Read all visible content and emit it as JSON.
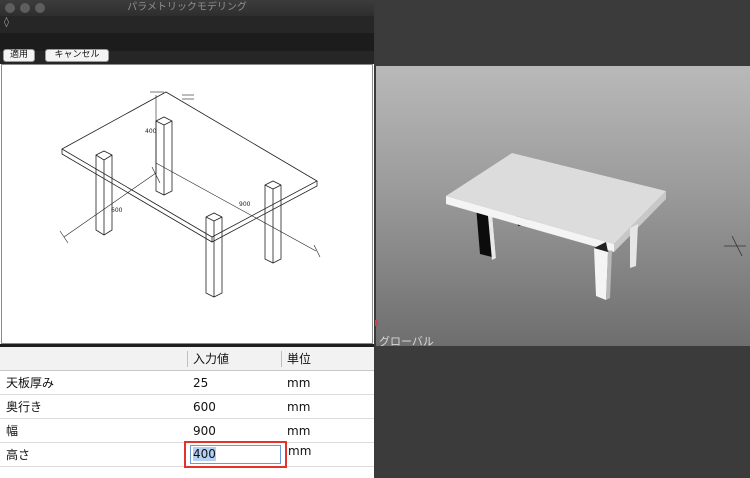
{
  "window": {
    "title": "パラメトリックモデリング",
    "toolbar_glyph": "◊"
  },
  "buttons": {
    "apply": "適用",
    "cancel": "キャンセル"
  },
  "drawing": {
    "dim_height": "400",
    "dim_depth": "600",
    "dim_width": "900"
  },
  "table": {
    "headers": {
      "name": "",
      "value": "入力値",
      "unit": "単位"
    },
    "rows": [
      {
        "name": "天板厚み",
        "value": "25",
        "unit": "mm"
      },
      {
        "name": "奥行き",
        "value": "600",
        "unit": "mm"
      },
      {
        "name": "幅",
        "value": "900",
        "unit": "mm"
      },
      {
        "name": "高さ",
        "value": "400",
        "unit": "mm"
      }
    ]
  },
  "viewport": {
    "space_label": "グローバル"
  },
  "colors": {
    "highlight": "#e4332a",
    "selection": "#b3d1f5"
  }
}
